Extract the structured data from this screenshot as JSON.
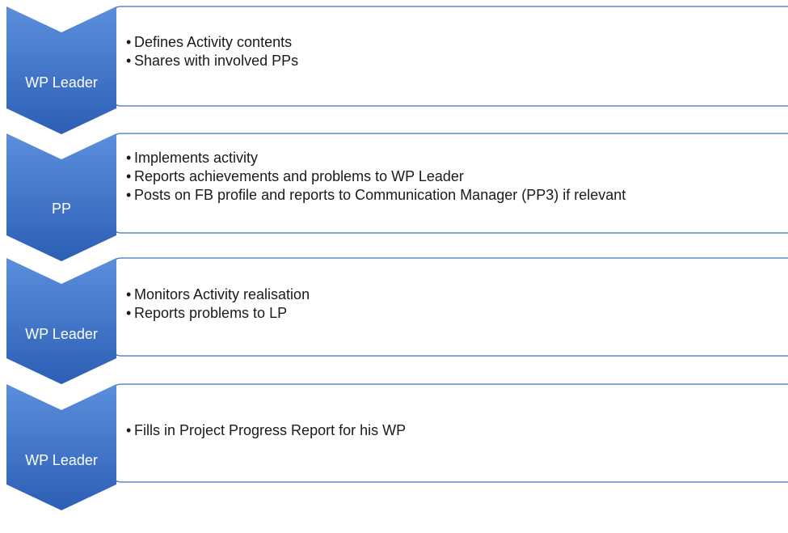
{
  "colors": {
    "chevron_top": "#5b8fdc",
    "chevron_bottom": "#2c5fb5",
    "box_border": "#3b6fc2",
    "text": "#1a1a1a"
  },
  "steps": [
    {
      "role": "WP Leader",
      "bullets": [
        "Defines Activity contents",
        "Shares with involved PPs"
      ]
    },
    {
      "role": "PP",
      "bullets": [
        "Implements activity",
        "Reports achievements and problems to WP Leader",
        "Posts on FB profile and reports to Communication Manager (PP3) if relevant"
      ]
    },
    {
      "role": "WP Leader",
      "bullets": [
        "Monitors Activity realisation",
        "Reports problems to LP"
      ]
    },
    {
      "role": "WP Leader",
      "bullets": [
        "Fills in Project Progress Report for his WP"
      ]
    }
  ]
}
